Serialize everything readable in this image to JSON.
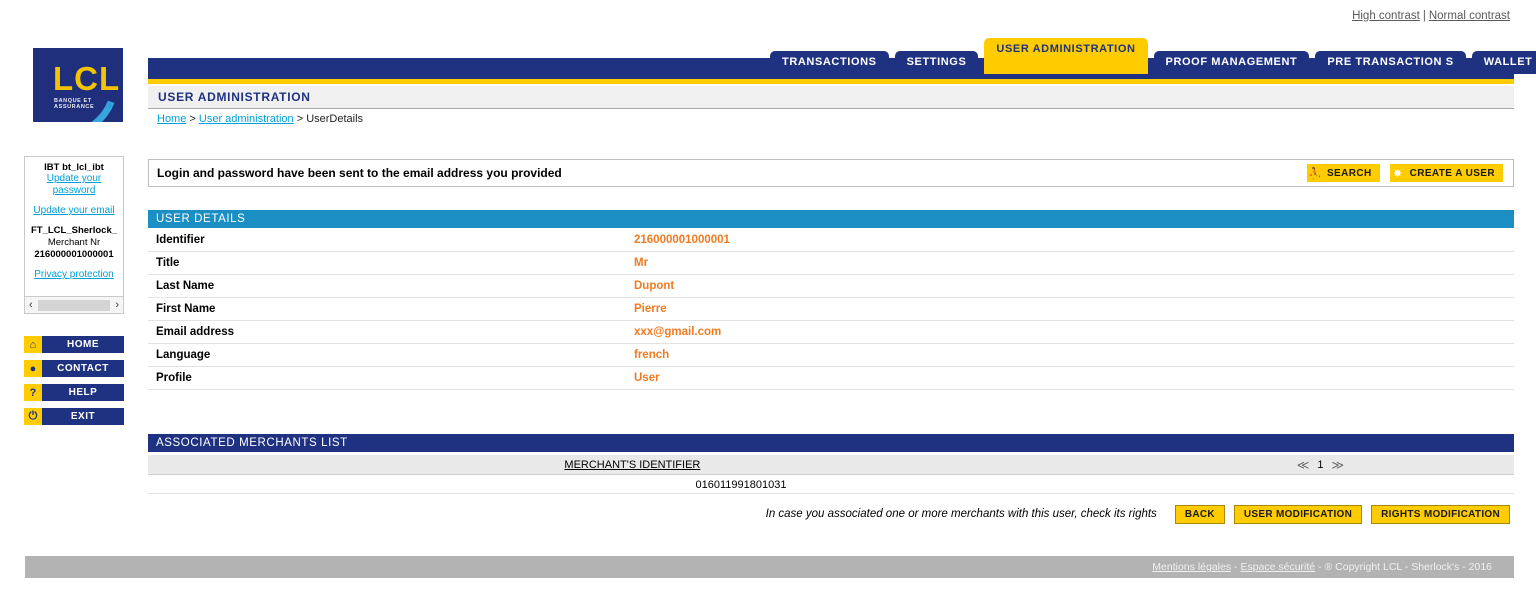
{
  "contrast": {
    "high": "High contrast",
    "separator": "|",
    "normal": "Normal contrast"
  },
  "logo": {
    "name": "LCL",
    "tagline": "BANQUE ET ASSURANCE"
  },
  "tabs": [
    {
      "label": "TRANSACTIONS",
      "active": false
    },
    {
      "label": "SETTINGS",
      "active": false
    },
    {
      "label": "USER ADMINISTRATION",
      "active": true
    },
    {
      "label": "PROOF MANAGEMENT",
      "active": false
    },
    {
      "label": "PRE TRANSACTION S",
      "active": false
    },
    {
      "label": "WALLET MANAGEMENT",
      "active": false
    }
  ],
  "page": {
    "title": "USER ADMINISTRATION"
  },
  "breadcrumb": {
    "home": "Home",
    "sep1": " > ",
    "section": "User administration",
    "sep2": " > ",
    "current": "UserDetails"
  },
  "sidebar": {
    "user_id": "IBT bt_lcl_ibt",
    "update_password_line1": "Update your",
    "update_password_line2": "password",
    "update_email": "Update your email",
    "merchant_name": "FT_LCL_Sherlock_",
    "merchant_nr_label": "Merchant Nr",
    "merchant_nr": "216000001000001",
    "privacy": "Privacy protection",
    "scroll_left": "‹",
    "scroll_right": "›",
    "nav": [
      {
        "label": "HOME",
        "icon": "home-icon",
        "glyph": "⌂"
      },
      {
        "label": "CONTACT",
        "icon": "speech-bubble-icon",
        "glyph": "●"
      },
      {
        "label": "HELP",
        "icon": "question-mark-icon",
        "glyph": "?"
      },
      {
        "label": "EXIT",
        "icon": "power-icon",
        "glyph": "⏻"
      }
    ]
  },
  "message": {
    "text": "Login and password have been sent to the email address you provided",
    "search_label": "SEARCH",
    "search_icon": "person-walking-icon",
    "search_glyph": "⛹",
    "create_label": "CREATE A USER",
    "create_icon": "starburst-icon",
    "create_glyph": "✸"
  },
  "user_details": {
    "section_title": "USER DETAILS",
    "rows": [
      {
        "label": "Identifier",
        "value": "216000001000001"
      },
      {
        "label": "Title",
        "value": "Mr"
      },
      {
        "label": "Last Name",
        "value": "Dupont"
      },
      {
        "label": "First Name",
        "value": "Pierre"
      },
      {
        "label": "Email address",
        "value": "xxx@gmail.com"
      },
      {
        "label": "Language",
        "value": "french"
      },
      {
        "label": "Profile",
        "value": "User"
      }
    ]
  },
  "merchants": {
    "section_title": "ASSOCIATED MERCHANTS LIST",
    "column_header": "MERCHANT'S IDENTIFIER",
    "rows": [
      {
        "identifier": "016011991801031"
      }
    ],
    "pager": {
      "first": "≪",
      "page": "1",
      "last": "≫"
    }
  },
  "actions": {
    "hint": "In case you associated one or more merchants with this user, check its rights",
    "back": "BACK",
    "user_modification": "USER MODIFICATION",
    "rights_modification": "RIGHTS MODIFICATION"
  },
  "footer": {
    "legal": "Mentions légales",
    "sep1": " - ",
    "security": "Espace sécurité",
    "copyright": " - ® Copyright LCL - Sherlock's - 2016"
  },
  "colors": {
    "navy": "#1f3282",
    "gold": "#ffcc00",
    "cyan": "#1b8fc4",
    "orange": "#f07b22",
    "link": "#00a0d8"
  }
}
